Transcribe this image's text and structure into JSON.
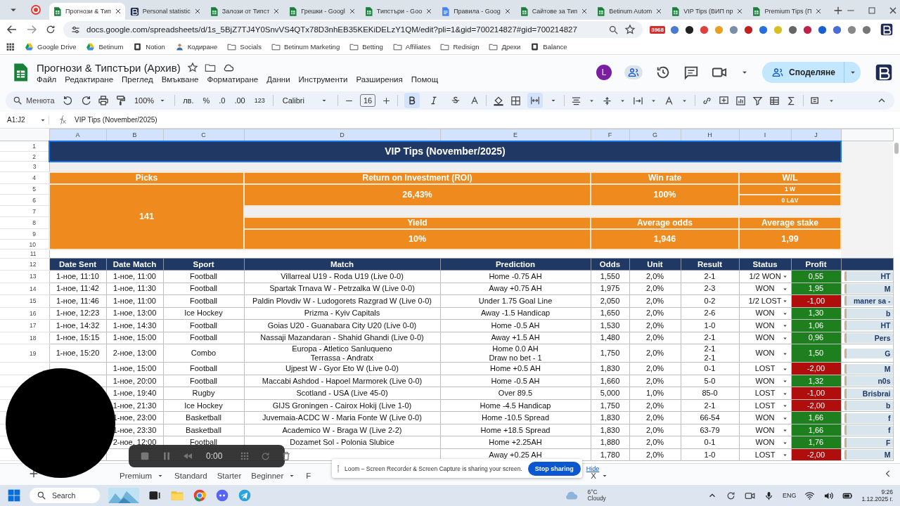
{
  "browser": {
    "tabs": [
      {
        "title": "Прогнози & Тип",
        "kind": "sheets",
        "selected": true
      },
      {
        "title": "Personal statistic",
        "kind": "site",
        "selected": false
      },
      {
        "title": "Залози от Типст",
        "kind": "sheets",
        "selected": false
      },
      {
        "title": "Грешки - Googl",
        "kind": "sheets",
        "selected": false
      },
      {
        "title": "Типстъри - Goo",
        "kind": "sheets",
        "selected": false
      },
      {
        "title": "Правила - Goog",
        "kind": "docs",
        "selected": false
      },
      {
        "title": "Сайтове за Тип",
        "kind": "sheets",
        "selected": false
      },
      {
        "title": "Betinum Autom",
        "kind": "sheets",
        "selected": false
      },
      {
        "title": "VIP Tips (ВИП пр",
        "kind": "sheets",
        "selected": false
      },
      {
        "title": "Premium Tips (П",
        "kind": "sheets",
        "selected": false
      }
    ],
    "address": "docs.google.com/spreadsheets/d/1s_5BjZ7TJ4Y0SnvVS4QTx78D3nhEB35KEKiDELzY1QM/edit?pli=1&gid=700214827#gid=700214827",
    "extension_badge": "3968",
    "bookmarks": [
      {
        "label": "Google Drive",
        "kind": "drive"
      },
      {
        "label": "Betinum",
        "kind": "drive"
      },
      {
        "label": "Notion",
        "kind": "site"
      },
      {
        "label": "Кодиране",
        "kind": "person"
      },
      {
        "label": "Socials",
        "kind": "folder"
      },
      {
        "label": "Betinum Marketing",
        "kind": "folder"
      },
      {
        "label": "Betting",
        "kind": "folder"
      },
      {
        "label": "Affiliates",
        "kind": "folder"
      },
      {
        "label": "Redisign",
        "kind": "folder"
      },
      {
        "label": "Дрехи",
        "kind": "folder"
      },
      {
        "label": "Balance",
        "kind": "site"
      }
    ]
  },
  "sheets": {
    "title": "Прогнози & Типстъри (Архив)",
    "menus": [
      "Файл",
      "Редактиране",
      "Преглед",
      "Вмъкване",
      "Форматиране",
      "Данни",
      "Инструменти",
      "Разширения",
      "Помощ"
    ],
    "account_initial": "L",
    "share_label": "Споделяне",
    "toolbar": {
      "search_placeholder": "Менюта",
      "zoom": "100%",
      "currency": "лв.",
      "percent": "%",
      "decrease_decimals": ".0",
      "increase_decimals": ".00",
      "number_format": "123",
      "font": "Calibri",
      "font_size": "16",
      "bold": true,
      "merge": true
    },
    "formula_bar": {
      "cell_ref": "A1:J2",
      "content": "VIP Tips (November/2025)"
    }
  },
  "grid": {
    "columns": [
      "A",
      "B",
      "C",
      "D",
      "E",
      "F",
      "G",
      "H",
      "I",
      "J"
    ],
    "row_numbers": [
      "1",
      "2",
      "3",
      "4",
      "5",
      "6",
      "7",
      "8",
      "9",
      "10",
      "11",
      "12",
      "13",
      "14",
      "15",
      "16",
      "17",
      "18",
      "19"
    ],
    "title": "VIP Tips (November/2025)",
    "summary": {
      "picks_label": "Picks",
      "picks": "141",
      "roi_label": "Return on Investment (ROI)",
      "roi": "26,43%",
      "win_rate_label": "Win rate",
      "win_rate": "100%",
      "wl_label": "W/L",
      "wins": "1 W",
      "losses": "0 L&V",
      "yield_label": "Yield",
      "yield": "10%",
      "avg_odds_label": "Average odds",
      "avg_odds": "1,946",
      "avg_stake_label": "Average stake",
      "avg_stake": "1,99"
    },
    "headers": [
      "Date Sent",
      "Date Match",
      "Sport",
      "Match",
      "Prediction",
      "Odds",
      "Unit",
      "Result",
      "Status",
      "Profit"
    ],
    "rows": [
      {
        "date_sent": "1-ное, 11:10",
        "date_match": "1-ное, 11:00",
        "sport": "Football",
        "match": "Villarreal U19 - Roda U19 (Live 0-0)",
        "prediction": "Home -0.75 AH",
        "odds": "1,550",
        "unit": "2,0%",
        "result": "2-1",
        "status": "1/2 WON",
        "profit": "0,55",
        "color": "#1e7f1e",
        "note": "HT"
      },
      {
        "date_sent": "1-ное, 11:42",
        "date_match": "1-ное, 11:30",
        "sport": "Football",
        "match": "Spartak Trnava W - Petrzalka W (Live 0-0)",
        "prediction": "Away +0.75 AH",
        "odds": "1,975",
        "unit": "2,0%",
        "result": "2-3",
        "status": "WON",
        "profit": "1,95",
        "color": "#1e7f1e",
        "note": "M"
      },
      {
        "date_sent": "1-ное, 11:46",
        "date_match": "1-ное, 11:00",
        "sport": "Football",
        "match": "Paldin Plovdiv W - Ludogorets Razgrad W (Live 0-0)",
        "prediction": "Under 1.75 Goal Line",
        "odds": "2,050",
        "unit": "2,0%",
        "result": "0-2",
        "status": "1/2 LOST",
        "profit": "-1,00",
        "color": "#b00d0d",
        "note": "maner sa -"
      },
      {
        "date_sent": "1-ное, 12:23",
        "date_match": "1-ное, 13:00",
        "sport": "Ice Hockey",
        "match": "Prizma - Kyiv Capitals",
        "prediction": "Away -1.5 Handicap",
        "odds": "1,650",
        "unit": "2,0%",
        "result": "2-6",
        "status": "WON",
        "profit": "1,30",
        "color": "#1e7f1e",
        "note": "b"
      },
      {
        "date_sent": "1-ное, 14:32",
        "date_match": "1-ное, 14:30",
        "sport": "Football",
        "match": "Goias U20 - Guanabara City U20 (Live 0-0)",
        "prediction": "Home -0.5 AH",
        "odds": "1,530",
        "unit": "2,0%",
        "result": "1-0",
        "status": "WON",
        "profit": "1,06",
        "color": "#1e7f1e",
        "note": "HT"
      },
      {
        "date_sent": "1-ное, 15:15",
        "date_match": "1-ное, 15:00",
        "sport": "Football",
        "match": "Nassaji Mazandaran - Shahid Ghandi (Live 0-0)",
        "prediction": "Away +1.5 AH",
        "odds": "1,480",
        "unit": "2,0%",
        "result": "2-1",
        "status": "WON",
        "profit": "0,96",
        "color": "#1e7f1e",
        "note": "Pers"
      },
      {
        "date_sent": "1-ное, 15:20",
        "date_match": "2-ное, 13:00",
        "sport": "Combo",
        "match": "Europa - Atletico Sanluqueno\nTerrassa - Andratx",
        "prediction": "Home 0.0 AH\nDraw no bet - 1",
        "odds": "1,750",
        "unit": "2,0%",
        "result": "2-1\n2-1",
        "status": "WON",
        "profit": "1,50",
        "color": "#1e7f1e",
        "note": "G"
      },
      {
        "date_match": "1-ное, 15:00",
        "sport": "Football",
        "match": "Ujpest W - Gyor Eto W (Live 0-0)",
        "prediction": "Home +0.5 AH",
        "odds": "1,830",
        "unit": "2,0%",
        "result": "0-1",
        "status": "LOST",
        "profit": "-2,00",
        "color": "#b00d0d",
        "note": "M"
      },
      {
        "date_match": "1-ное, 20:00",
        "sport": "Football",
        "match": "Maccabi Ashdod - Hapoel Marmorek (Live 0-0)",
        "prediction": "Home -0.5 AH",
        "odds": "1,660",
        "unit": "2,0%",
        "result": "5-0",
        "status": "WON",
        "profit": "1,32",
        "color": "#1e7f1e",
        "note": "n0s"
      },
      {
        "date_match": "1-ное, 19:40",
        "sport": "Rugby",
        "match": "Scotland - USA (Live 45-0)",
        "prediction": "Over 89.5",
        "odds": "5,000",
        "unit": "1,0%",
        "result": "85-0",
        "status": "LOST",
        "profit": "-1,00",
        "color": "#b00d0d",
        "note": "Brisbrai"
      },
      {
        "date_match": "1-ное, 21:30",
        "sport": "Ice Hockey",
        "match": "GIJS Groningen - Cairox Hokij (Live 1-0)",
        "prediction": "Home -4.5 Handicap",
        "odds": "1,750",
        "unit": "2,0%",
        "result": "2-1",
        "status": "LOST",
        "profit": "-2,00",
        "color": "#b00d0d",
        "note": "b"
      },
      {
        "date_match": "1-ное, 23:00",
        "sport": "Basketball",
        "match": "Juvemaia-ACDC W - Maria Fonte W (Live 0-0)",
        "prediction": "Home -10.5 Spread",
        "odds": "1,830",
        "unit": "2,0%",
        "result": "66-54",
        "status": "WON",
        "profit": "1,66",
        "color": "#1e7f1e",
        "note": "f"
      },
      {
        "date_match": "1-ное, 23:30",
        "sport": "Basketball",
        "match": "Academico W - Braga W (Live 2-2)",
        "prediction": "Home +18.5 Spread",
        "odds": "1,830",
        "unit": "2,0%",
        "result": "63-79",
        "status": "WON",
        "profit": "1,66",
        "color": "#1e7f1e",
        "note": "f"
      },
      {
        "date_match": "2-ное, 12:00",
        "sport": "Football",
        "match": "Dozamet Sol - Polonia Slubice",
        "prediction": "Home +2.25AH",
        "odds": "1,880",
        "unit": "2,0%",
        "result": "0-1",
        "status": "WON",
        "profit": "1,76",
        "color": "#1e7f1e",
        "note": "F"
      },
      {
        "prediction": "Away +0.25 AH",
        "odds": "1,780",
        "unit": "2,0%",
        "result": "1-0",
        "status": "LOST",
        "profit": "-2,00",
        "color": "#b00d0d",
        "note": "M"
      }
    ]
  },
  "sheet_tabs": [
    {
      "label": "Premium",
      "dropdown": true
    },
    {
      "label": "Standard",
      "dropdown": false
    },
    {
      "label": "Starter",
      "dropdown": false
    },
    {
      "label": "Beginner",
      "dropdown": true
    },
    {
      "label": "F",
      "dropdown": false
    },
    {
      "label": "X",
      "dropdown": true
    }
  ],
  "recorder": {
    "time": "0:00"
  },
  "share_notice": {
    "message": "Loom – Screen Recorder & Screen Capture is sharing your screen.",
    "stop_label": "Stop sharing",
    "hide_label": "Hide"
  },
  "taskbar": {
    "search": "Search",
    "temperature": "6°C",
    "weather": "Cloudy",
    "language": "ENG",
    "time": "9:26",
    "date": "1.12.2025 г."
  }
}
